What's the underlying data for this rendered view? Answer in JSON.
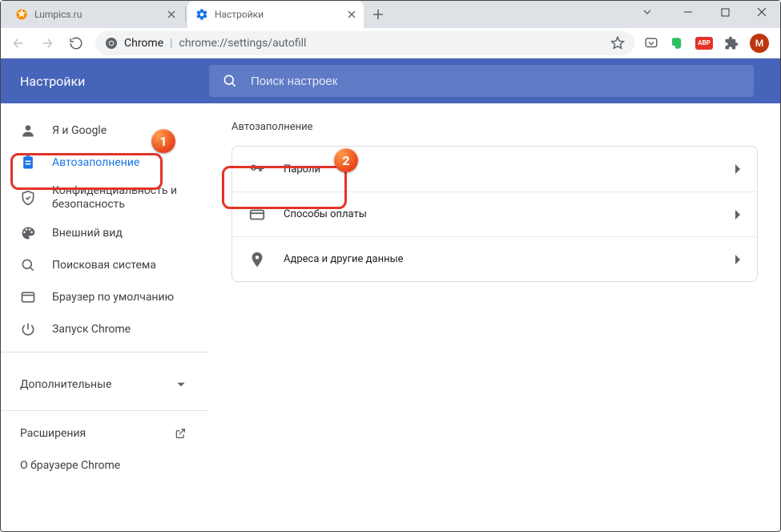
{
  "window": {
    "tabs": [
      {
        "title": "Lumpics.ru",
        "favicon_color": "#fb8c00"
      },
      {
        "title": "Настройки"
      }
    ],
    "controls": {
      "minimize": "—",
      "maximize": "□",
      "close": "✕"
    }
  },
  "addressbar": {
    "security_label": "Chrome",
    "url": "chrome://settings/autofill"
  },
  "toolbar_icons": {
    "star": "star-icon",
    "pocket": "pocket-icon",
    "evernote": "evernote-icon",
    "abp": "ABP",
    "extensions": "puzzle-icon",
    "avatar_letter": "M"
  },
  "header": {
    "title": "Настройки",
    "search_placeholder": "Поиск настроек"
  },
  "sidebar": {
    "items": [
      {
        "label": "Я и Google"
      },
      {
        "label": "Автозаполнение"
      },
      {
        "label": "Конфиденциальность и безопасность"
      },
      {
        "label": "Внешний вид"
      },
      {
        "label": "Поисковая система"
      },
      {
        "label": "Браузер по умолчанию"
      },
      {
        "label": "Запуск Chrome"
      }
    ],
    "advanced_label": "Дополнительные",
    "extensions_label": "Расширения",
    "about_label": "О браузере Chrome"
  },
  "main": {
    "section_title": "Автозаполнение",
    "rows": [
      {
        "label": "Пароли"
      },
      {
        "label": "Способы оплаты"
      },
      {
        "label": "Адреса и другие данные"
      }
    ]
  },
  "annotations": {
    "badge1": "1",
    "badge2": "2"
  }
}
